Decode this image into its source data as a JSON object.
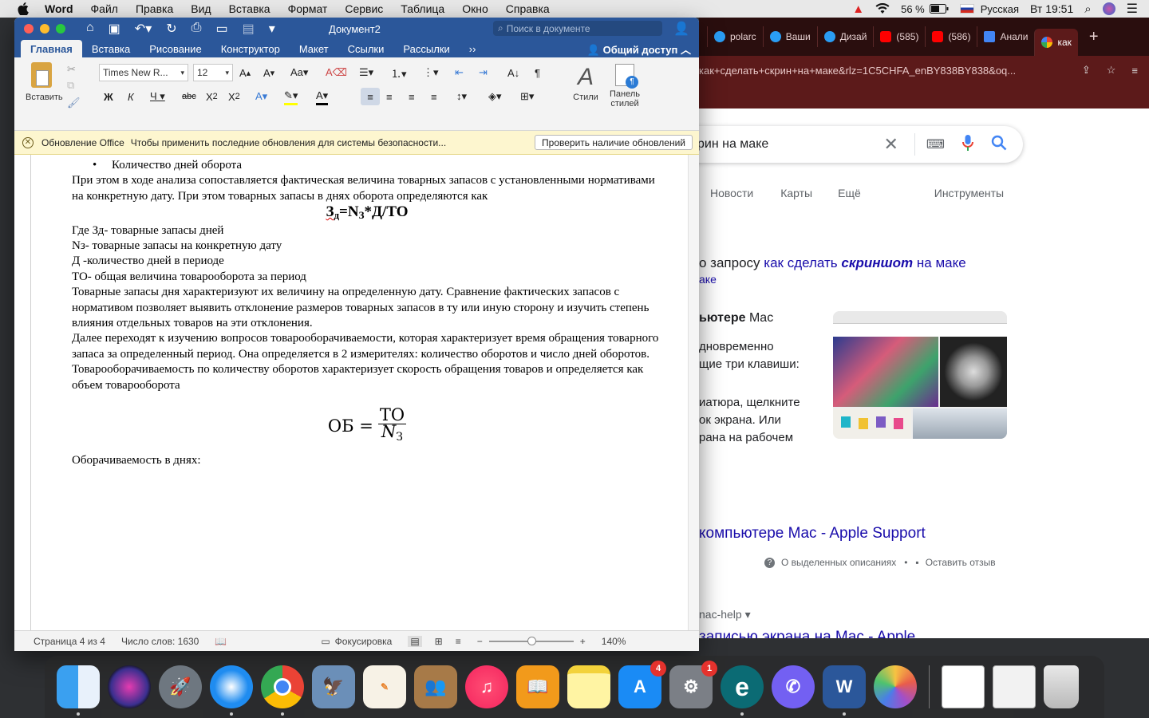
{
  "menubar": {
    "app": "Word",
    "items": [
      "Файл",
      "Правка",
      "Вид",
      "Вставка",
      "Формат",
      "Сервис",
      "Таблица",
      "Окно",
      "Справка"
    ],
    "battery": "56 %",
    "lang": "Русская",
    "time": "Вт 19:51"
  },
  "browser": {
    "tabs": [
      "polarc",
      "Ваши",
      "Дизай",
      "(585)",
      "(586)",
      "Анали",
      "как"
    ],
    "url": "как+сделать+скрин+на+маке&rlz=1C5CHFA_enBY838BY838&oq...",
    "query": "рин на маке",
    "nav": [
      "Новости",
      "Карты",
      "Ещё",
      "Инструменты"
    ],
    "result_prefix": "о запросу",
    "result_link1": "как сделать",
    "result_bold": "скриншот",
    "result_link2": "на маке",
    "result_sub": "аке",
    "snip_bold": "ьютере",
    "snip_mac": "Mac",
    "snippet": [
      "дновременно",
      "щие три клавиши:",
      "",
      "иатюра, щелкните",
      "ок экрана. Или",
      "рана на рабочем"
    ],
    "support_link": "компьютере Mac - Apple Support",
    "feedback1": "О выделенных описаниях",
    "feedback2": "Оставить отзыв",
    "crumb": "nac-help",
    "next_link": "записью экрана на Mac - Apple"
  },
  "word": {
    "doc_title": "Документ2",
    "search_placeholder": "Поиск в документе",
    "tabs": [
      "Главная",
      "Вставка",
      "Рисование",
      "Конструктор",
      "Макет",
      "Ссылки",
      "Рассылки"
    ],
    "share": "Общий доступ",
    "font_name": "Times New R...",
    "font_size": "12",
    "paste": "Вставить",
    "styles": "Стили",
    "panel1": "Панель",
    "panel2": "стилей",
    "notice_title": "Обновление Office",
    "notice_text": "Чтобы применить последние обновления для системы безопасности...",
    "notice_button": "Проверить наличие обновлений",
    "doc": {
      "bullet": "Количество дней оборота",
      "p1": "При этом в ходе анализа сопоставляется фактическая величина товарных запасов с установленными нормативами на конкретную дату. При этом товарных запасы в днях оборота определяются как",
      "f1_a": "З",
      "f1_sub": "д",
      "f1_b": "=N",
      "f1_sub2": "З",
      "f1_c": "*Д/ТО",
      "l1": "Где Зд- товарные запасы дней",
      "l2": "Nз- товарные запасы на конкретную дату",
      "l3": "Д -количество дней в периоде",
      "l4": "ТО- общая величина товарооборота за период",
      "p2": "Товарные запасы дня характеризуют их величину на определенную дату. Сравнение фактических запасов с нормативом позволяет выявить отклонение размеров товарных запасов в ту или иную сторону и изучить степень влияния отдельных товаров на эти отклонения.",
      "p3": "Далее переходят к изучению вопросов товарооборачиваемости, которая характеризует время обращения товарного запаса за определенный период. Она определяется в 2 измерителях: количество оборотов и число дней оборотов.",
      "p4": "Товарооборачиваемость по количеству оборотов характеризует скорость обращения товаров и определяется как объем товарооборота",
      "f2_left": "ОБ =",
      "f2_num": "ТО",
      "f2_den": "N",
      "f2_den_sub": "З",
      "p5": "Оборачиваемость в днях:"
    },
    "status": {
      "page": "Страница 4 из 4",
      "words": "Число слов: 1630",
      "focus": "Фокусировка",
      "zoom": "140%"
    }
  },
  "dock": {
    "badges": [
      "4",
      "1"
    ]
  },
  "colors": {
    "word_blue": "#2b579a",
    "chrome_dark": "#5c1a1a",
    "link": "#1a0dab"
  }
}
